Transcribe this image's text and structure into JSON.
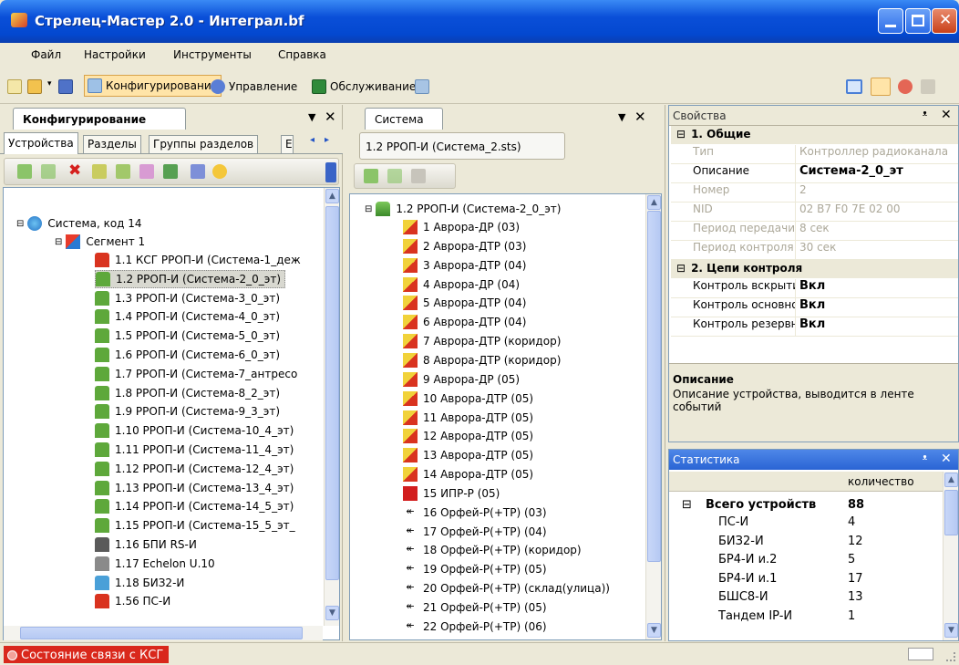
{
  "window": {
    "title": "Стрелец-Мастер 2.0 - Интеграл.bf"
  },
  "menu": [
    "Файл",
    "Настройки",
    "Инструменты",
    "Справка"
  ],
  "toolbar": {
    "configure": "Конфигурирование",
    "control": "Управление",
    "service": "Обслуживание"
  },
  "left_panel": {
    "title": "Конфигурирование",
    "tabs": [
      "Устройства",
      "Разделы",
      "Группы разделов",
      "Е"
    ],
    "tree_root": "Система, код 14",
    "tree_segment": "Сегмент 1",
    "items": [
      "1.1 КСГ РРОП-И (Система-1_деж",
      "1.2 РРОП-И (Система-2_0_эт)",
      "1.3 РРОП-И (Система-3_0_эт)",
      "1.4 РРОП-И (Система-4_0_эт)",
      "1.5 РРОП-И (Система-5_0_эт)",
      "1.6 РРОП-И (Система-6_0_эт)",
      "1.7 РРОП-И (Система-7_антресо",
      "1.8 РРОП-И (Система-8_2_эт)",
      "1.9 РРОП-И (Система-9_3_эт)",
      "1.10 РРОП-И (Система-10_4_эт)",
      "1.11 РРОП-И (Система-11_4_эт)",
      "1.12 РРОП-И (Система-12_4_эт)",
      "1.13 РРОП-И (Система-13_4_эт)",
      "1.14 РРОП-И (Система-14_5_эт)",
      "1.15 РРОП-И (Система-15_5_эт_",
      "1.16 БПИ RS-И",
      "1.17 Echelon U.10",
      "1.18 БИЗ2-И",
      "1.56 ПС-И"
    ]
  },
  "mid_panel": {
    "title": "Система",
    "subtab": "1.2 РРОП-И (Система_2.sts)",
    "root": "1.2 РРОП-И (Система-2_0_эт)",
    "items": [
      "1 Аврора-ДР (03)",
      "2 Аврора-ДТР (03)",
      "3 Аврора-ДТР (04)",
      "4 Аврора-ДР (04)",
      "5 Аврора-ДТР (04)",
      "6 Аврора-ДТР (04)",
      "7 Аврора-ДТР (коридор)",
      "8 Аврора-ДТР (коридор)",
      "9 Аврора-ДР (05)",
      "10 Аврора-ДТР (05)",
      "11 Аврора-ДТР (05)",
      "12 Аврора-ДТР (05)",
      "13 Аврора-ДТР (05)",
      "14 Аврора-ДТР (05)",
      "15 ИПР-Р (05)",
      "16 Орфей-Р(+ТР) (03)",
      "17 Орфей-Р(+ТР) (04)",
      "18 Орфей-Р(+ТР) (коридор)",
      "19 Орфей-Р(+ТР) (05)",
      "20 Орфей-Р(+ТР) (склад(улица))",
      "21 Орфей-Р(+ТР) (05)",
      "22 Орфей-Р(+ТР) (06)"
    ]
  },
  "properties": {
    "title": "Свойства",
    "cat1": "1. Общие",
    "rows1": [
      {
        "k": "Тип",
        "v": "Контроллер радиоканала"
      },
      {
        "k": "Описание",
        "v": "Система-2_0_эт"
      },
      {
        "k": "Номер",
        "v": "2"
      },
      {
        "k": "NID",
        "v": "02 B7 F0 7E 02 00"
      },
      {
        "k": "Период передачи и",
        "v": "8 сек"
      },
      {
        "k": "Период контроля",
        "v": "30 сек"
      }
    ],
    "cat2": "2. Цепи контроля",
    "rows2": [
      {
        "k": "Контроль вскрыти",
        "v": "Вкл"
      },
      {
        "k": "Контроль основно",
        "v": "Вкл"
      },
      {
        "k": "Контроль резервн",
        "v": "Вкл"
      }
    ],
    "desc_title": "Описание",
    "desc_text": "Описание устройства, выводится в ленте событий"
  },
  "stats": {
    "title": "Статистика",
    "col": "количество",
    "total_label": "Всего устройств",
    "total": "88",
    "rows": [
      {
        "k": "ПС-И",
        "v": "4"
      },
      {
        "k": "БИЗ2-И",
        "v": "12"
      },
      {
        "k": "БР4-И и.2",
        "v": "5"
      },
      {
        "k": "БР4-И и.1",
        "v": "17"
      },
      {
        "k": "БШС8-И",
        "v": "13"
      },
      {
        "k": "Тандем IP-И",
        "v": "1"
      }
    ]
  },
  "status": {
    "text": "Состояние связи с КСГ"
  },
  "colors": {
    "title_bar": "#0A4FD8",
    "panel_border": "#7f9db9",
    "selected_tb": "#FFE4A8",
    "status_red": "#d9281c"
  }
}
